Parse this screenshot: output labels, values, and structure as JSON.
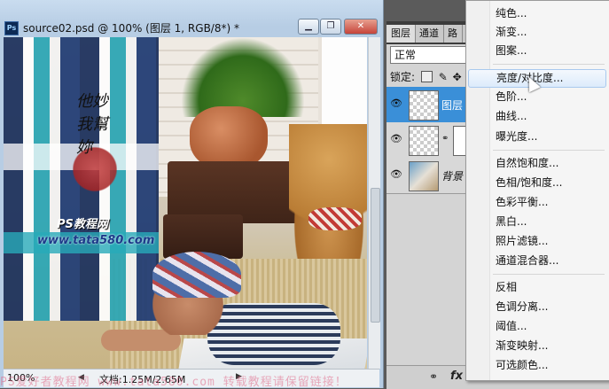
{
  "document": {
    "title": "source02.psd @ 100% (图层 1, RGB/8*) *",
    "app_badge": "Ps",
    "buttons": {
      "minimize": "▁",
      "restore": "❐",
      "close": "✕"
    },
    "watermark_calligraphy": "他妙我幫妳",
    "watermark_line1": "PS教程网",
    "watermark_line2": "www.tata580.com",
    "status": {
      "zoom": "100%",
      "doc_size": "文档:1.25M/2.65M"
    }
  },
  "layers_panel": {
    "tabs": [
      "图层",
      "通道",
      "路"
    ],
    "blend_mode": "正常",
    "lock_label": "锁定:",
    "layers": [
      {
        "name": "图层",
        "selected": true,
        "type": "transparent"
      },
      {
        "name": "",
        "selected": false,
        "type": "with-mask"
      },
      {
        "name": "背景",
        "selected": false,
        "type": "photo"
      }
    ],
    "bottom_fx": "fx",
    "bottom_link": "⚭"
  },
  "adjust_menu": {
    "groups": [
      [
        "纯色...",
        "渐变...",
        "图案..."
      ],
      [
        "亮度/对比度...",
        "色阶...",
        "曲线...",
        "曝光度..."
      ],
      [
        "自然饱和度...",
        "色相/饱和度...",
        "色彩平衡...",
        "黑白...",
        "照片滤镜...",
        "通道混合器..."
      ],
      [
        "反相",
        "色调分离...",
        "阈值...",
        "渐变映射...",
        "可选颜色..."
      ]
    ],
    "hover_item": "亮度/对比度..."
  },
  "bottom_watermark": "PS爱好者教程网 www.tata580.com 转载教程请保留链接！",
  "colors": {
    "accent": "#3a8fd8",
    "menu_bg": "#f5f5f5",
    "titlebar": "#c9dcef"
  }
}
